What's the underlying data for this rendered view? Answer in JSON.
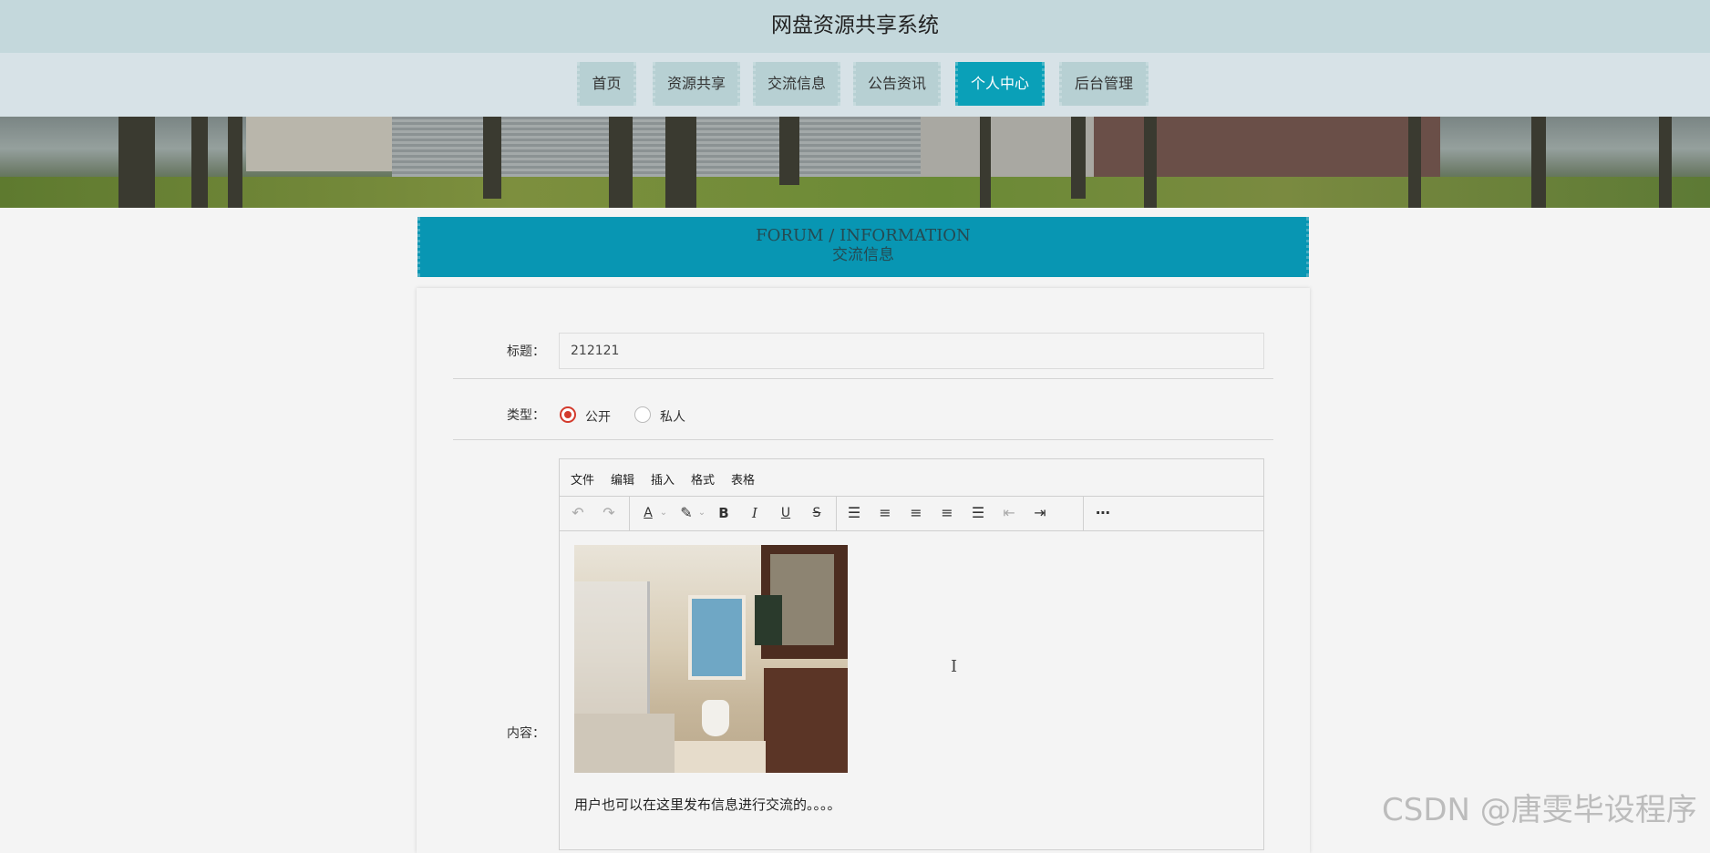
{
  "app": {
    "title": "网盘资源共享系统"
  },
  "nav": {
    "items": [
      {
        "label": "首页"
      },
      {
        "label": "资源共享"
      },
      {
        "label": "交流信息"
      },
      {
        "label": "公告资讯"
      },
      {
        "label": "个人中心"
      },
      {
        "label": "后台管理"
      }
    ],
    "active": "个人中心"
  },
  "section": {
    "en_title": "FORUM / INFORMATION",
    "cn_title": "交流信息"
  },
  "form": {
    "title_label": "标题：",
    "title_value": "212121",
    "type_label": "类型：",
    "type_options": [
      "公开",
      "私人"
    ],
    "type_selected": "公开",
    "content_label": "内容："
  },
  "editor": {
    "menus": [
      "文件",
      "编辑",
      "插入",
      "格式",
      "表格"
    ],
    "content_text": "用户也可以在这里发布信息进行交流的。。。。",
    "toolbar_icons": [
      "undo-icon",
      "redo-icon",
      "font-color-icon",
      "highlight-icon",
      "bold-icon",
      "italic-icon",
      "underline-icon",
      "strikethrough-icon",
      "line-height-icon",
      "align-left-icon",
      "align-center-icon",
      "align-right-icon",
      "align-justify-icon",
      "outdent-icon",
      "indent-icon",
      "more-icon"
    ]
  },
  "watermark": "CSDN @唐雯毕设程序",
  "colors": {
    "accent": "#0aa0b8",
    "header": "#c4d8dc",
    "radio_checked": "#d33a2c"
  }
}
